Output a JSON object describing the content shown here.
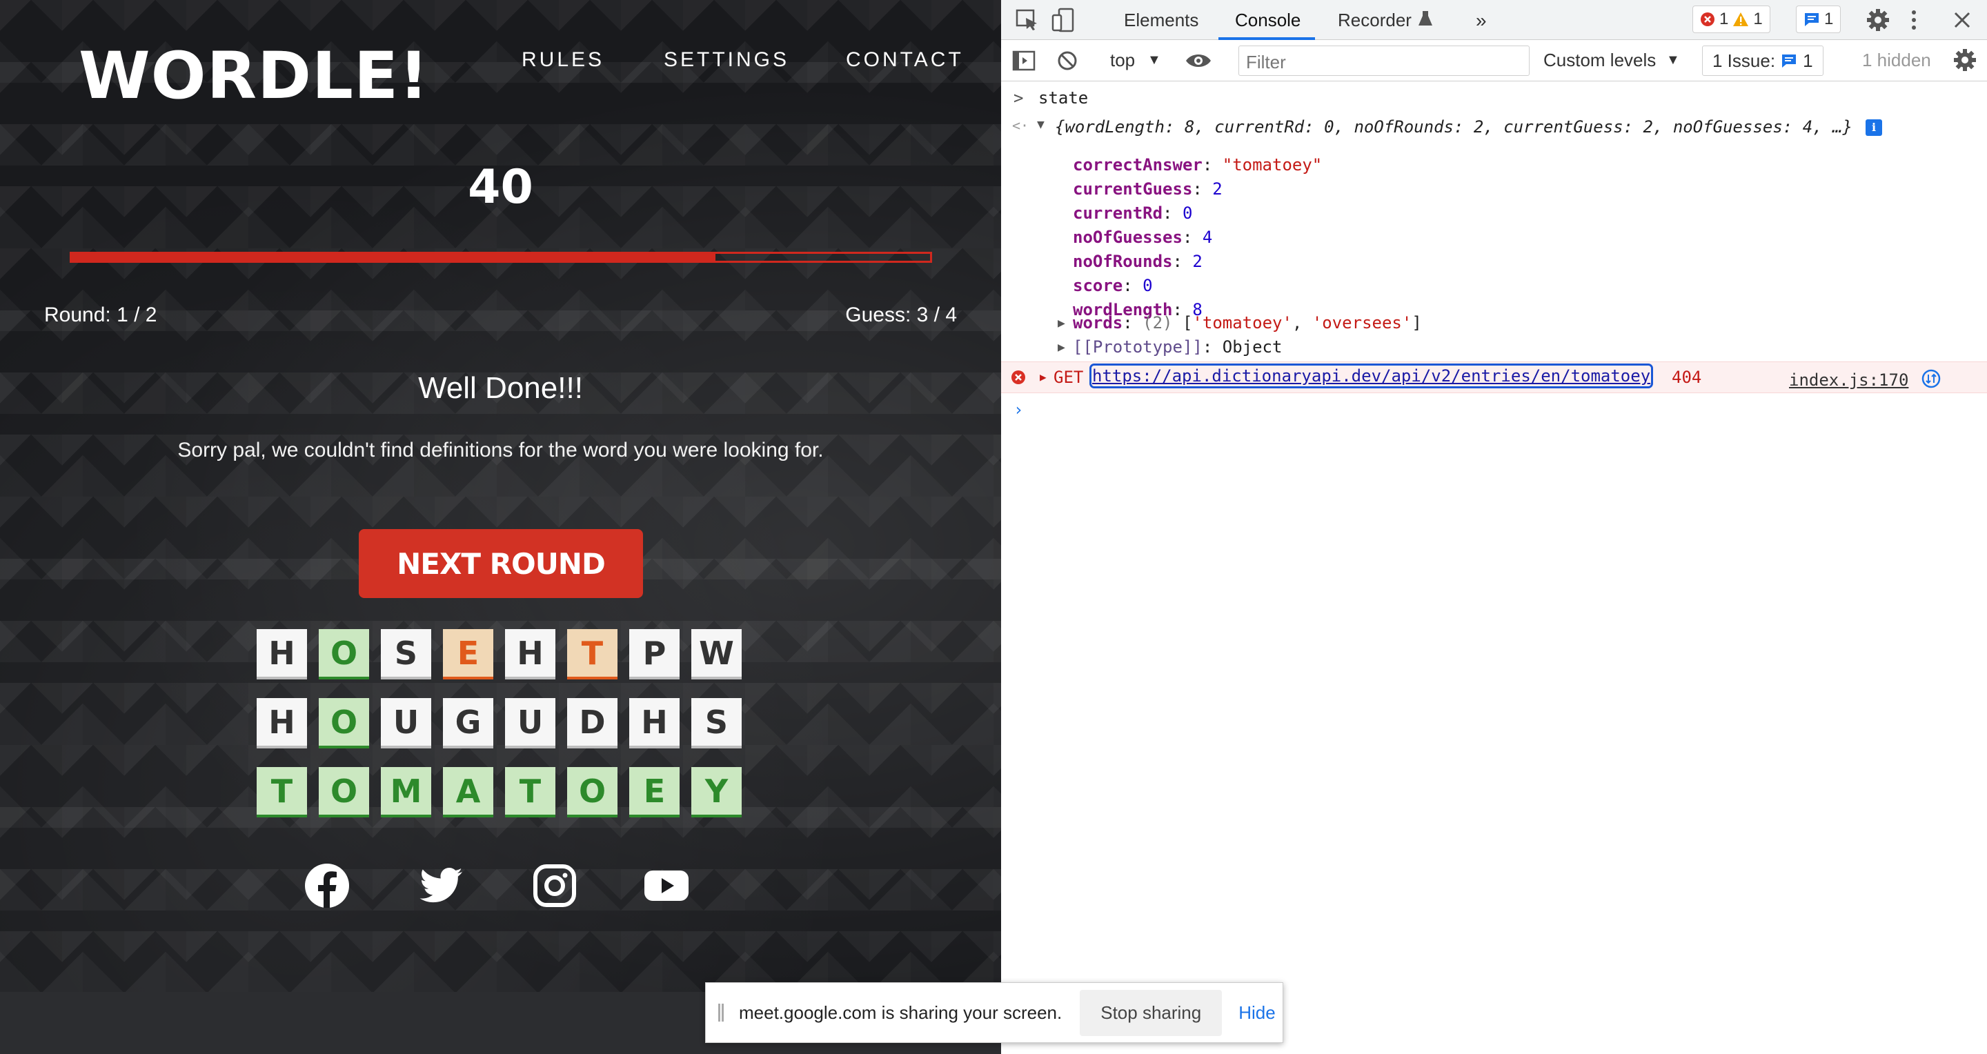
{
  "game": {
    "logo": "WORDLE!",
    "nav": {
      "rules": "RULES",
      "settings": "SETTINGS",
      "contact": "CONTACT"
    },
    "score": "40",
    "progress_fraction": 0.75,
    "round_text": "Round: 1 / 2",
    "guess_text": "Guess: 3 / 4",
    "message_title": "Well Done!!!",
    "message_body": "Sorry pal, we couldn't find definitions for the word you were looking for.",
    "next_button": "NEXT ROUND",
    "accent_color": "#d23224",
    "board": [
      [
        {
          "l": "H",
          "s": "absent"
        },
        {
          "l": "O",
          "s": "correct"
        },
        {
          "l": "S",
          "s": "absent"
        },
        {
          "l": "E",
          "s": "present"
        },
        {
          "l": "H",
          "s": "absent"
        },
        {
          "l": "T",
          "s": "present"
        },
        {
          "l": "P",
          "s": "absent"
        },
        {
          "l": "W",
          "s": "absent"
        }
      ],
      [
        {
          "l": "H",
          "s": "absent"
        },
        {
          "l": "O",
          "s": "correct"
        },
        {
          "l": "U",
          "s": "absent"
        },
        {
          "l": "G",
          "s": "absent"
        },
        {
          "l": "U",
          "s": "absent"
        },
        {
          "l": "D",
          "s": "absent"
        },
        {
          "l": "H",
          "s": "absent"
        },
        {
          "l": "S",
          "s": "absent"
        }
      ],
      [
        {
          "l": "T",
          "s": "correct"
        },
        {
          "l": "O",
          "s": "correct"
        },
        {
          "l": "M",
          "s": "correct"
        },
        {
          "l": "A",
          "s": "correct"
        },
        {
          "l": "T",
          "s": "correct"
        },
        {
          "l": "O",
          "s": "correct"
        },
        {
          "l": "E",
          "s": "correct"
        },
        {
          "l": "Y",
          "s": "correct"
        }
      ]
    ],
    "socials": [
      "facebook-icon",
      "twitter-icon",
      "instagram-icon",
      "youtube-icon"
    ]
  },
  "devtools": {
    "tabs": {
      "elements": "Elements",
      "console": "Console",
      "recorder": "Recorder"
    },
    "badges": {
      "errors": "1",
      "warnings": "1",
      "messages": "1"
    },
    "toolbar": {
      "context": "top",
      "filter_placeholder": "Filter",
      "levels": "Custom levels",
      "issues": "1 Issue:",
      "issues_count": "1",
      "hidden": "1 hidden"
    },
    "console": {
      "input": "state",
      "summary": "{wordLength: 8, currentRd: 0, noOfRounds: 2, currentGuess: 2, noOfGuesses: 4, …}",
      "props": [
        {
          "key": "correctAnswer",
          "value": "\"tomatoey\"",
          "kind": "str"
        },
        {
          "key": "currentGuess",
          "value": "2",
          "kind": "num"
        },
        {
          "key": "currentRd",
          "value": "0",
          "kind": "num"
        },
        {
          "key": "noOfGuesses",
          "value": "4",
          "kind": "num"
        },
        {
          "key": "noOfRounds",
          "value": "2",
          "kind": "num"
        },
        {
          "key": "score",
          "value": "0",
          "kind": "num"
        },
        {
          "key": "wordLength",
          "value": "8",
          "kind": "num"
        }
      ],
      "words_key": "words",
      "words_count": "(2)",
      "words_list": [
        "'tomatoey'",
        "'oversees'"
      ],
      "proto_key": "[[Prototype]]",
      "proto_value": "Object",
      "error_method": "GET",
      "error_url": "https://api.dictionaryapi.dev/api/v2/entries/en/tomatoey",
      "error_status": "404",
      "error_source": "index.js:170"
    }
  },
  "share_bar": {
    "text": "meet.google.com is sharing your screen.",
    "stop": "Stop sharing",
    "hide": "Hide"
  }
}
